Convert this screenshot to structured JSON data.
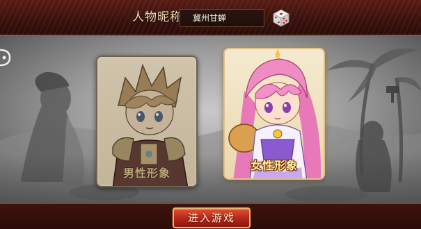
{
  "profile": {
    "nickname_label": "人物昵称",
    "nickname_value": "冀州甘蝉",
    "dice_icon": "dice-icon"
  },
  "characters": [
    {
      "id": "male",
      "label": "男性形象",
      "selected": false
    },
    {
      "id": "female",
      "label": "女性形象",
      "selected": true
    }
  ],
  "actions": {
    "enter_game": "进入游戏"
  },
  "colors": {
    "top_bar": "#3c120d",
    "card_border": "#c7a572",
    "button": "#b8281a",
    "label_gold": "#fff1a6"
  }
}
